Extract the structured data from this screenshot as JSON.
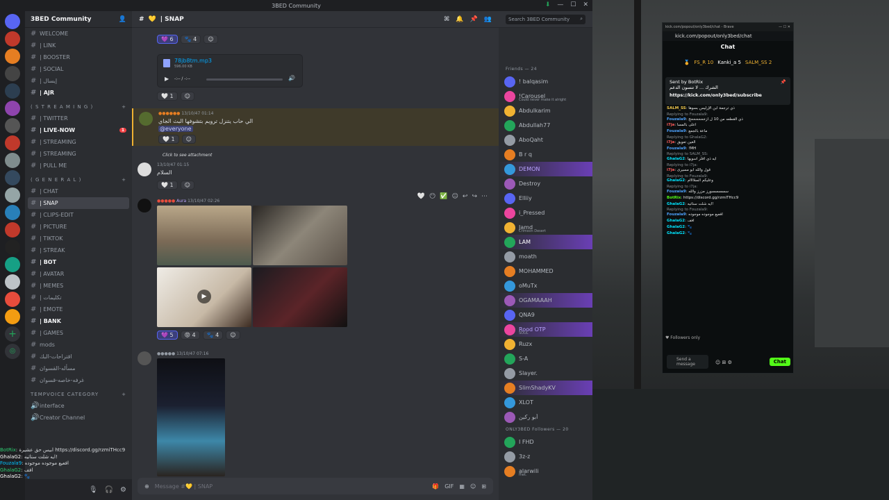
{
  "window": {
    "title": "3BED Community"
  },
  "guild": {
    "name": "3BED Community"
  },
  "channels": [
    {
      "name": "WELCOME",
      "emoji": "",
      "state": "normal"
    },
    {
      "name": "| LINK",
      "state": "normal"
    },
    {
      "name": "| BOOSTER",
      "state": "normal"
    },
    {
      "name": "| SOCIAL",
      "state": "normal"
    },
    {
      "name": "| إيسال",
      "state": "normal"
    },
    {
      "name": "| AJR",
      "state": "unread"
    }
  ],
  "cat_streaming": "( S T R E A M I N G )",
  "streaming_channels": [
    {
      "name": "| TWITTER",
      "state": "normal"
    },
    {
      "name": "| LIVE-NOW",
      "state": "unread",
      "badge": "1"
    },
    {
      "name": "| STREAMING",
      "state": "normal"
    },
    {
      "name": "| STREAMING",
      "state": "normal"
    },
    {
      "name": "| PULL ME",
      "state": "normal"
    }
  ],
  "cat_general": "( G E N E R A L )",
  "general_channels": [
    {
      "name": "| CHAT",
      "state": "normal"
    },
    {
      "name": "| SNAP",
      "state": "active"
    },
    {
      "name": "| CLIPS-EDIT",
      "state": "normal"
    },
    {
      "name": "| PICTURE",
      "state": "normal"
    },
    {
      "name": "| TIKTOK",
      "state": "normal"
    },
    {
      "name": "| STREAK",
      "state": "normal"
    },
    {
      "name": "| BOT",
      "state": "unread"
    },
    {
      "name": "| AVATAR",
      "state": "normal"
    },
    {
      "name": "| MEMES",
      "state": "normal"
    },
    {
      "name": "| تكليمات",
      "state": "normal"
    },
    {
      "name": "| EMOTE",
      "state": "normal"
    },
    {
      "name": "| BANK",
      "state": "unread"
    },
    {
      "name": "| GAMES",
      "state": "normal"
    },
    {
      "name": "mods",
      "state": "normal"
    },
    {
      "name": "اقتراحات-البك",
      "state": "normal"
    },
    {
      "name": "مسأله-القسوان",
      "state": "normal"
    },
    {
      "name": "غرفه-خاصه-قسوان",
      "state": "normal"
    }
  ],
  "cat_tempvoice": "TEMPVOICE CATEGORY",
  "tempvoice_channels": [
    {
      "name": "interface"
    },
    {
      "name": "Creator Channel"
    }
  ],
  "channel_header": {
    "name": "| SNAP",
    "emoji": "💛"
  },
  "search": {
    "placeholder": "Search 3BED Community"
  },
  "messages": {
    "reactions1": [
      "6",
      "4"
    ],
    "audio": {
      "filename": "78jb8tm.mp3",
      "size": "596.00 KB",
      "time": "-:-- / -:--"
    },
    "reactions2": [
      "1"
    ],
    "m3": {
      "author": "",
      "time": "13/10/47 01:14",
      "text": "الي حاب يتنزل ترويم بتشوفها البث الجاي",
      "mention": "@everyone",
      "reactions": [
        "1"
      ]
    },
    "m4": {
      "reply": "Click to see attachment",
      "time": "13/10/47 01:15",
      "text": "السلام",
      "reactions": [
        "1"
      ]
    },
    "m5": {
      "role": "Aura",
      "time": "13/10/47 02:26",
      "reactions": [
        "5",
        "4",
        "4"
      ]
    },
    "m6": {
      "time": "13/10/47 07:16"
    }
  },
  "composer": {
    "placeholder": "Message #💛 | SNAP"
  },
  "members": {
    "friends_header": "Friends — 24",
    "followers_header": "ONLY3BED Followers — 20",
    "list": [
      {
        "name": "! balqasim",
        "sub": "",
        "color": "#b5bac1"
      },
      {
        "name": "!Carousel",
        "sub": "Could never make it alright",
        "color": "#b5bac1"
      },
      {
        "name": "Abdulkarim",
        "sub": "",
        "color": "#b5bac1"
      },
      {
        "name": "Abdullah77",
        "sub": "",
        "color": "#b5bac1"
      },
      {
        "name": "AboQaht",
        "sub": "",
        "color": "#b5bac1"
      },
      {
        "name": "B r q",
        "sub": "",
        "color": "#b5bac1"
      },
      {
        "name": "DEMON",
        "sub": "",
        "color": "#b9a3ff",
        "hl": true
      },
      {
        "name": "Destroy",
        "sub": "",
        "color": "#b5bac1"
      },
      {
        "name": "Elliiy",
        "sub": "",
        "color": "#b5bac1"
      },
      {
        "name": "i_Pressed",
        "sub": "",
        "color": "#b5bac1"
      },
      {
        "name": "Jamd",
        "sub": "Crimson Desert",
        "color": "#b5bac1"
      },
      {
        "name": "LAM",
        "sub": "",
        "color": "#ffffff",
        "hl": true
      },
      {
        "name": "moath",
        "sub": "",
        "color": "#b5bac1"
      },
      {
        "name": "MOHAMMED",
        "sub": "",
        "color": "#b5bac1"
      },
      {
        "name": "oMuTx",
        "sub": "",
        "color": "#b5bac1"
      },
      {
        "name": "OGAMAAAH",
        "sub": "",
        "color": "#b5bac1",
        "hl": true
      },
      {
        "name": "QNA9",
        "sub": "",
        "color": "#b5bac1"
      },
      {
        "name": "Rood OTP",
        "sub": "SOUL",
        "color": "#b9a3ff",
        "hl": true
      },
      {
        "name": "Ruzx",
        "sub": "",
        "color": "#b5bac1"
      },
      {
        "name": "S-A",
        "sub": "",
        "color": "#b5bac1"
      },
      {
        "name": "Slayer.",
        "sub": "",
        "color": "#b5bac1"
      },
      {
        "name": "SlimShadyKV",
        "sub": "",
        "color": "#b5bac1",
        "hl": true
      },
      {
        "name": "XLOT",
        "sub": "",
        "color": "#b5bac1"
      },
      {
        "name": "أبو ركين",
        "sub": "",
        "color": "#b5bac1"
      }
    ],
    "followers": [
      {
        "name": "I FHD",
        "sub": ""
      },
      {
        "name": "3z-z",
        "sub": ""
      },
      {
        "name": "alarwili",
        "sub": "fhet."
      }
    ]
  },
  "kick": {
    "window_title": "kick.com/popout/only3bed/chat - Brave",
    "url": "kick.com/popout/only3bed/chat",
    "title": "Chat",
    "leaderboard": [
      "FS_R 10",
      "Kanki_a 5",
      "SALM_SS 2"
    ],
    "pinned_by": "Sent by BotRix",
    "pinned_text": "الشرك ... لا تنسون الدعم",
    "pinned_link": "https://kick.com/only3bed/subscribe",
    "lines": [
      {
        "reply": "",
        "user": "SALM_SS",
        "text": "ذي ترجمة ابن الإرليس بسوها",
        "color": "#f2c94c"
      },
      {
        "reply": "Replying to Fouzala9:",
        "user": "Fouzala9",
        "text": "ذي القطعه من 10 ل ازخحححححح",
        "color": "#4ea3ff"
      },
      {
        "reply": "",
        "user": "i7ja",
        "text": "اعلى بالمسا",
        "color": "#ff5c5c"
      },
      {
        "reply": "",
        "user": "Fouzala9",
        "text": "ماعة بالجمع",
        "color": "#4ea3ff"
      },
      {
        "reply": "Replying to GhalaG2:",
        "user": "i7ja",
        "text": "الغين تعويق",
        "color": "#ff5c5c"
      },
      {
        "reply": "",
        "user": "Fouzala9",
        "text": "!MH",
        "color": "#4ea3ff"
      },
      {
        "reply": "Replying to SALM_SS:",
        "user": "GhalaG2",
        "text": "ايه ذي افلز اسويها",
        "color": "#00e5ff"
      },
      {
        "reply": "Replying to i7ja:",
        "user": "i7ja",
        "text": "قول والله ابو مسيرى",
        "color": "#ff5c5c"
      },
      {
        "reply": "Replying to Fouzala9:",
        "user": "GhalaG2",
        "text": "وعليكم السلاااام",
        "color": "#00e5ff"
      },
      {
        "reply": "Replying to i7ja:",
        "user": "Fouzala9",
        "text": "سسسسسورز مزرز والله",
        "color": "#4ea3ff"
      },
      {
        "reply": "",
        "user": "BotRix",
        "text": "https://discord.gg/rzmiTHcc9",
        "color": "#53fc18"
      },
      {
        "reply": "",
        "user": "GhalaG2",
        "text": "ايه شلت ستاتيه!",
        "color": "#00e5ff"
      },
      {
        "reply": "Replying to Fouzala9:",
        "user": "Fouzala9",
        "text": "افعيع موجوده موجوده",
        "color": "#4ea3ff"
      },
      {
        "reply": "",
        "user": "GhalaG2",
        "text": "افف",
        "color": "#00e5ff"
      },
      {
        "reply": "",
        "user": "GhalaG2",
        "text": "🐾",
        "color": "#00e5ff"
      },
      {
        "reply": "",
        "user": "GhalaG2",
        "text": "🐾",
        "color": "#00e5ff"
      }
    ],
    "followers_only": "Followers only",
    "input_placeholder": "Send a message",
    "chat_button": "Chat"
  },
  "overlay": [
    {
      "user": "BotRix",
      "text": ": ابيس حق عشيرة https://discord.gg/rzmiTHcc9"
    },
    {
      "user": "GhalaG2",
      "text": ": ايه شلت ستاتيه!"
    },
    {
      "user": "Fouzala9",
      "text": ": افعيع موجوده موجوده"
    },
    {
      "user": "GhalaG2",
      "text": ": افف"
    },
    {
      "user": "GhalaG2",
      "text": ": 🐾"
    }
  ]
}
